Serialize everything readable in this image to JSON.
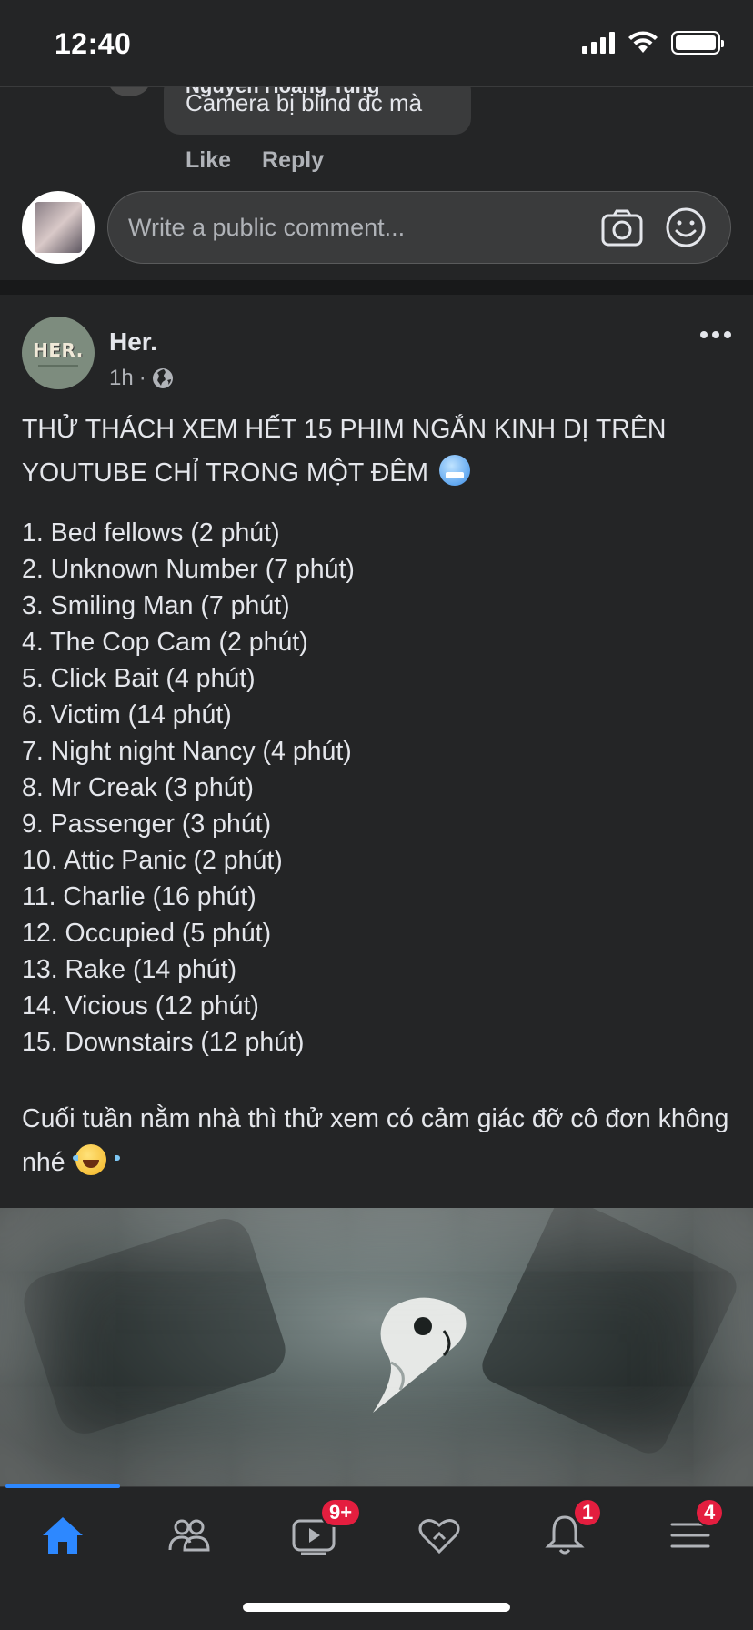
{
  "status_bar": {
    "time": "12:40"
  },
  "previous_comment": {
    "author": "Nguyen Hoang Tung",
    "text": "Camera bị blind đc mà",
    "like_label": "Like",
    "reply_label": "Reply"
  },
  "comment_composer": {
    "placeholder": "Write a public comment..."
  },
  "post": {
    "page_name": "Her.",
    "avatar_text": "HER.",
    "time": "1h",
    "separator": "·",
    "headline": "THỬ THÁCH XEM HẾT 15 PHIM NGẮN KINH DỊ TRÊN YOUTUBE CHỈ TRONG MỘT ĐÊM",
    "list": [
      "1. Bed fellows (2 phút)",
      "2. Unknown Number (7 phút)",
      "3. Smiling Man (7 phút)",
      "4. The Cop Cam (2 phút)",
      "5. Click Bait (4 phút)",
      "6. Victim (14 phút)",
      "7. Night night Nancy (4 phút)",
      "8. Mr Creak (3 phút)",
      "9. Passenger (3 phút)",
      "10. Attic Panic (2 phút)",
      "11. Charlie (16 phút)",
      "12. Occupied (5 phút)",
      "13. Rake (14 phút)",
      "14. Vicious (12 phút)",
      "15. Downstairs (12 phút)"
    ],
    "closing": "Cuối tuần nằm nhà thì thử xem có cảm giác đỡ cô đơn không nhé"
  },
  "tab_bar": {
    "tabs": [
      {
        "name": "home",
        "icon": "home-icon",
        "active": true
      },
      {
        "name": "friends",
        "icon": "friends-icon"
      },
      {
        "name": "watch",
        "icon": "video-icon",
        "badge": "9+"
      },
      {
        "name": "dating",
        "icon": "heart-icon"
      },
      {
        "name": "notifications",
        "icon": "bell-icon",
        "badge": "1"
      },
      {
        "name": "menu",
        "icon": "menu-icon",
        "badge": "4"
      }
    ]
  },
  "colors": {
    "accent": "#2d88ff",
    "badge": "#e41e3f",
    "background": "#242526"
  }
}
